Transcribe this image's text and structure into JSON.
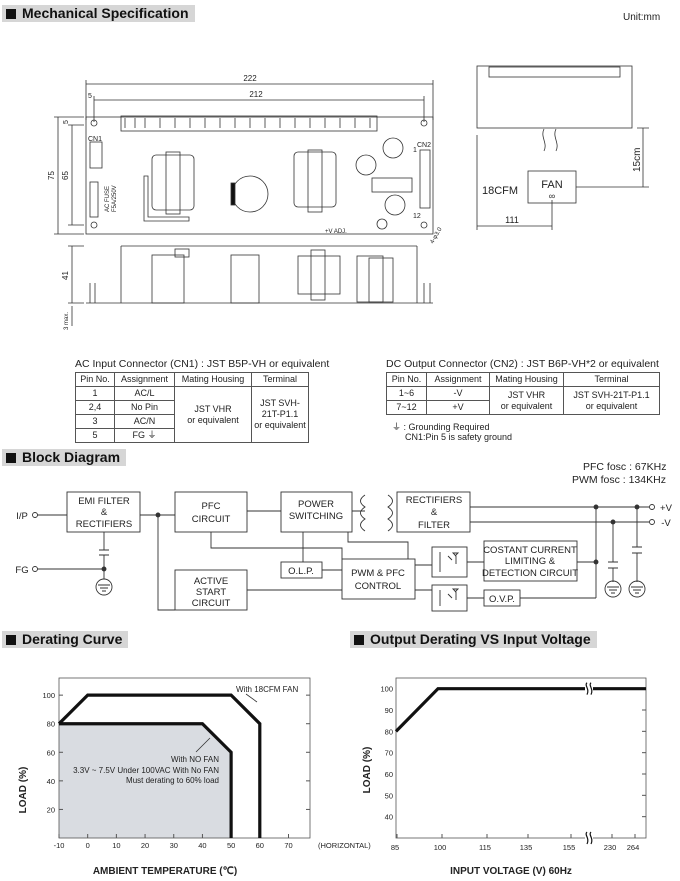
{
  "sections": {
    "mechanical": "Mechanical Specification",
    "unit": "Unit:mm",
    "block": "Block Diagram",
    "derating": "Derating Curve",
    "output_derating": "Output Derating VS Input Voltage"
  },
  "mechanical": {
    "dim_222": "222",
    "dim_212": "212",
    "dim_5a": "5",
    "dim_5b": "5",
    "dim_75": "75",
    "dim_65": "65",
    "dim_41": "41",
    "dim_3max": "3 max.",
    "cn1": "CN1",
    "cn2": "CN2",
    "pin1": "1",
    "pin12": "12",
    "fuse": "AC FUSE",
    "fuse_rating": "F5A/250V",
    "vadj": "+V ADJ.",
    "hole": "4-φ3.0",
    "fan_label": "FAN",
    "fan_cfm": "18CFM",
    "fan_dist": "15cm",
    "fan_offset": "111"
  },
  "ac_connector": {
    "title": "AC Input Connector (CN1) : JST B5P-VH or equivalent",
    "headers": [
      "Pin No.",
      "Assignment",
      "Mating Housing",
      "Terminal"
    ],
    "rows": [
      [
        "1",
        "AC/L"
      ],
      [
        "2,4",
        "No Pin"
      ],
      [
        "3",
        "AC/N"
      ],
      [
        "5",
        "FG ⏚"
      ]
    ],
    "housing": [
      "JST VHR",
      "or equivalent"
    ],
    "terminal": [
      "JST SVH-21T-P1.1",
      "or equivalent"
    ]
  },
  "dc_connector": {
    "title": "DC Output Connector (CN2) : JST B6P-VH*2 or equivalent",
    "headers": [
      "Pin No.",
      "Assignment",
      "Mating Housing",
      "Terminal"
    ],
    "rows": [
      [
        "1~6",
        "-V"
      ],
      [
        "7~12",
        "+V"
      ]
    ],
    "housing": [
      "JST VHR",
      "or equivalent"
    ],
    "terminal": [
      "JST SVH-21T-P1.1",
      "or equivalent"
    ],
    "note1": "⏚ : Grounding Required",
    "note2": "CN1:Pin 5 is safety ground"
  },
  "block": {
    "pfc_fosc": "PFC fosc : 67KHz",
    "pwm_fosc": "PWM fosc : 134KHz",
    "ip": "I/P",
    "fg": "FG",
    "pos": "+V",
    "neg": "-V",
    "emi": [
      "EMI FILTER",
      "&",
      "RECTIFIERS"
    ],
    "pfc": [
      "PFC",
      "CIRCUIT"
    ],
    "psw": [
      "POWER",
      "SWITCHING"
    ],
    "rect": [
      "RECTIFIERS",
      "&",
      "FILTER"
    ],
    "olp": "O.L.P.",
    "pwm": [
      "PWM & PFC",
      "CONTROL"
    ],
    "active": [
      "ACTIVE",
      "START",
      "CIRCUIT"
    ],
    "ccl": [
      "COSTANT CURRENT",
      "LIMITING &",
      "DETECTION CIRCUIT"
    ],
    "ovp": "O.V.P."
  },
  "chart_data": [
    {
      "type": "line",
      "xlabel": "AMBIENT TEMPERATURE (℃)",
      "ylabel": "LOAD (%)",
      "x_ticks": [
        "-10",
        "0",
        "10",
        "20",
        "30",
        "40",
        "50",
        "60",
        "70"
      ],
      "x_suffix": "(HORIZONTAL)",
      "y_ticks": [
        "20",
        "40",
        "60",
        "80",
        "100"
      ],
      "xlim": [
        -10,
        77.5
      ],
      "ylim": [
        0,
        112
      ],
      "series": [
        {
          "name": "With 18CFM FAN",
          "points": [
            [
              -10,
              80
            ],
            [
              0,
              100
            ],
            [
              50,
              100
            ],
            [
              60,
              80
            ],
            [
              60,
              0
            ]
          ]
        },
        {
          "name": "With NO FAN",
          "points": [
            [
              -10,
              80
            ],
            [
              40,
              80
            ],
            [
              50,
              60
            ],
            [
              50,
              0
            ]
          ],
          "filled": true
        }
      ],
      "annotation": [
        "3.3V ~ 7.5V Under 100VAC With No FAN",
        "Must derating to 60% load"
      ],
      "fill_color": "#d9dce1"
    },
    {
      "type": "line",
      "xlabel": "INPUT VOLTAGE (V) 60Hz",
      "ylabel": "LOAD (%)",
      "x_ticks": [
        "85",
        "100",
        "115",
        "135",
        "155",
        "230",
        "264"
      ],
      "y_ticks": [
        "40",
        "50",
        "60",
        "70",
        "80",
        "90",
        "100"
      ],
      "ylim": [
        30,
        105
      ],
      "axis_break": "between 155 and 230",
      "series": [
        {
          "points": [
            [
              85,
              80
            ],
            [
              100,
              100
            ],
            [
              264,
              100
            ]
          ]
        }
      ]
    }
  ]
}
